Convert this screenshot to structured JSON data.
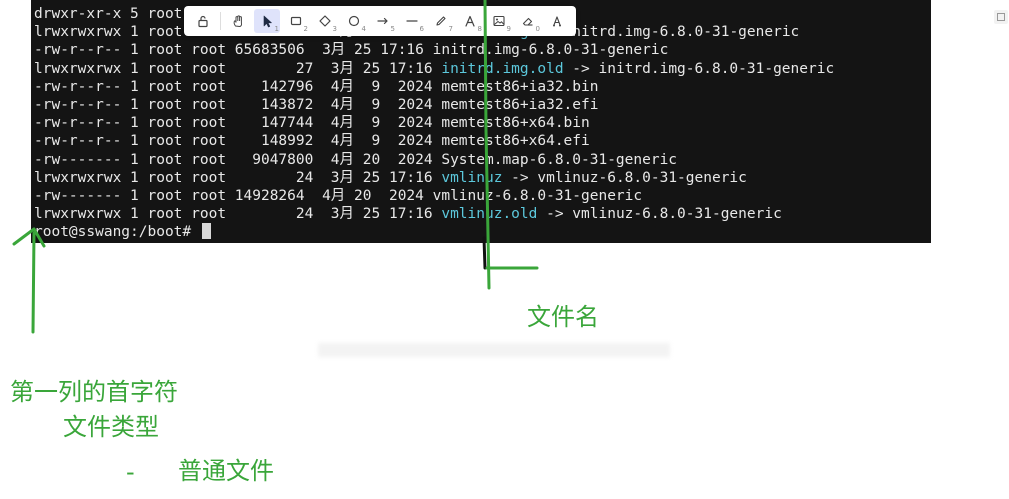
{
  "terminal": {
    "background": "#141414",
    "text_color": "#e8e8e8",
    "link_color": "#5cc8dc",
    "lines": [
      {
        "text": "drwxr-xr-x 5 root root      4096  3月 25 17:16 grub",
        "link": ""
      },
      {
        "text": "lrwxrwxrwx 1 root root        27  3月 25 17:16 ",
        "link": "initrd.img",
        "after": " -> initrd.img-6.8.0-31-generic"
      },
      {
        "text": "-rw-r--r-- 1 root root 65683506  3月 25 17:16 initrd.img-6.8.0-31-generic",
        "link": ""
      },
      {
        "text": "lrwxrwxrwx 1 root root        27  3月 25 17:16 ",
        "link": "initrd.img.old",
        "after": " -> initrd.img-6.8.0-31-generic"
      },
      {
        "text": "-rw-r--r-- 1 root root    142796  4月  9  2024 memtest86+ia32.bin",
        "link": ""
      },
      {
        "text": "-rw-r--r-- 1 root root    143872  4月  9  2024 memtest86+ia32.efi",
        "link": ""
      },
      {
        "text": "-rw-r--r-- 1 root root    147744  4月  9  2024 memtest86+x64.bin",
        "link": ""
      },
      {
        "text": "-rw-r--r-- 1 root root    148992  4月  9  2024 memtest86+x64.efi",
        "link": ""
      },
      {
        "text": "-rw------- 1 root root   9047800  4月 20  2024 System.map-6.8.0-31-generic",
        "link": ""
      },
      {
        "text": "lrwxrwxrwx 1 root root        24  3月 25 17:16 ",
        "link": "vmlinuz",
        "after": " -> vmlinuz-6.8.0-31-generic"
      },
      {
        "text": "-rw------- 1 root root 14928264  4月 20  2024 vmlinuz-6.8.0-31-generic",
        "link": ""
      },
      {
        "text": "lrwxrwxrwx 1 root root        24  3月 25 17:16 ",
        "link": "vmlinuz.old",
        "after": " -> vmlinuz-6.8.0-31-generic"
      }
    ],
    "prompt": "root@sswang:/boot# "
  },
  "toolbar": {
    "tools": [
      {
        "icon": "lock-icon",
        "num": ""
      },
      {
        "icon": "hand-icon",
        "num": ""
      },
      {
        "icon": "pointer-icon",
        "num": "1",
        "active": true
      },
      {
        "icon": "rectangle-icon",
        "num": "2"
      },
      {
        "icon": "diamond-icon",
        "num": "3"
      },
      {
        "icon": "ellipse-icon",
        "num": "4"
      },
      {
        "icon": "arrow-icon",
        "num": "5"
      },
      {
        "icon": "line-icon",
        "num": "6"
      },
      {
        "icon": "pencil-icon",
        "num": "7"
      },
      {
        "icon": "text-icon",
        "num": "8"
      },
      {
        "icon": "image-icon",
        "num": "9"
      },
      {
        "icon": "eraser-icon",
        "num": "0"
      },
      {
        "icon": "library-icon",
        "num": ""
      }
    ]
  },
  "annotations": {
    "color": "#3aa63a",
    "filename": "文件名",
    "first_char": "第一列的首字符",
    "file_type": "文件类型",
    "dash": "-",
    "regular_file": "普通文件"
  }
}
